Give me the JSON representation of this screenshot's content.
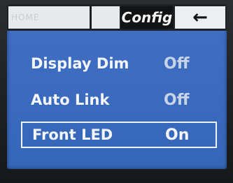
{
  "tabs": {
    "home_label": "HOME",
    "config_label": "Config",
    "back_glyph": "←"
  },
  "settings": [
    {
      "label": "Display Dim",
      "value": "Off"
    },
    {
      "label": "Auto Link",
      "value": "Off"
    },
    {
      "label": "Front LED",
      "value": "On",
      "selected": true
    }
  ],
  "colors": {
    "screen_bg": "#3c6bc0",
    "tab_active_bg": "#111315",
    "tab_inactive_bg": "#e7eaed",
    "text": "#f3f6fa"
  }
}
